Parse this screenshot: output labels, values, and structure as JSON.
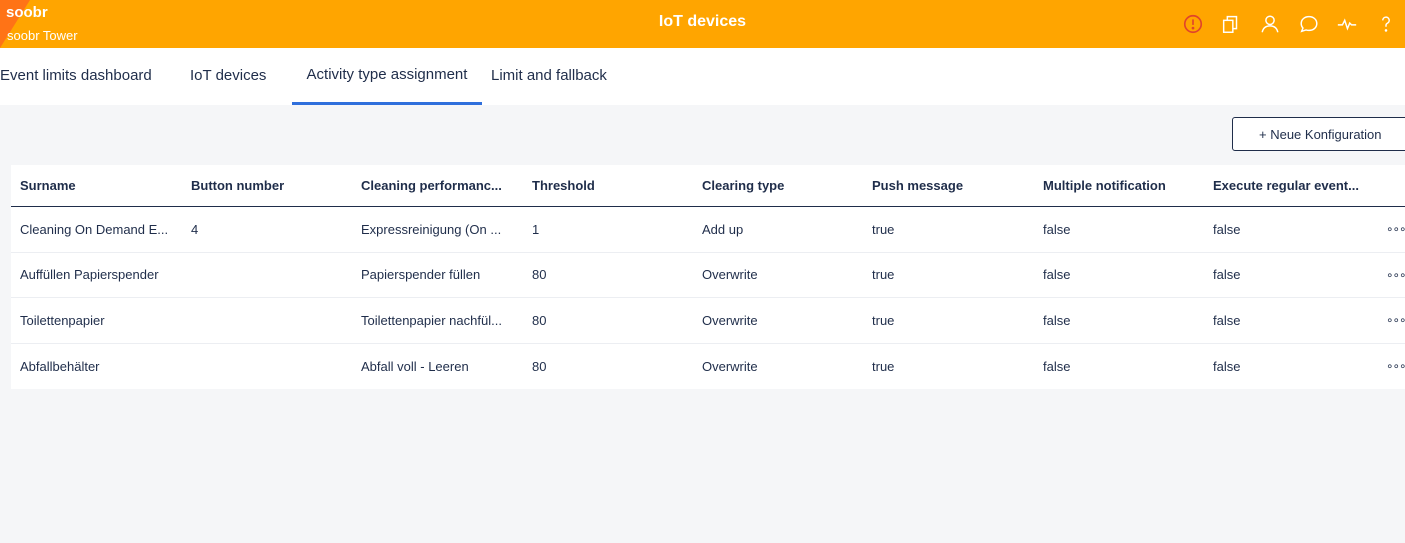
{
  "header": {
    "brand": "soobr",
    "subtitle": "soobr Tower",
    "title": "IoT devices",
    "accent_color": "#ffa500",
    "alert_color": "#e0442b",
    "icons": [
      "alert-icon",
      "copy-icon",
      "user-icon",
      "chat-icon",
      "activity-icon",
      "help-icon"
    ]
  },
  "tabs": [
    {
      "label": "Event limits dashboard"
    },
    {
      "label": "IoT devices"
    },
    {
      "label": "Activity type assignment",
      "active": true
    },
    {
      "label": "Limit and fallback"
    }
  ],
  "actions": {
    "new_config": "+ Neue Konfiguration"
  },
  "table": {
    "columns": [
      "Surname",
      "Button number",
      "Cleaning performanc...",
      "Threshold",
      "Clearing type",
      "Push message",
      "Multiple notification",
      "Execute regular event..."
    ],
    "rows": [
      [
        "Cleaning On Demand E...",
        "4",
        "Expressreinigung (On ...",
        "1",
        "Add up",
        "true",
        "false",
        "false"
      ],
      [
        "Auffüllen Papierspender",
        "",
        "Papierspender füllen",
        "80",
        "Overwrite",
        "true",
        "false",
        "false"
      ],
      [
        "Toilettenpapier",
        "",
        "Toilettenpapier nachfül...",
        "80",
        "Overwrite",
        "true",
        "false",
        "false"
      ],
      [
        "Abfallbehälter",
        "",
        "Abfall voll - Leeren",
        "80",
        "Overwrite",
        "true",
        "false",
        "false"
      ]
    ],
    "row_menu_icon": "more-options-icon",
    "row_menu_glyph": "∘∘∘"
  }
}
